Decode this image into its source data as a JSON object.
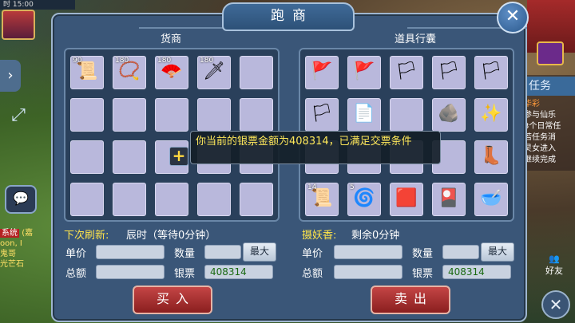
{
  "background": {
    "time_label": "时 15:00",
    "left_tab_icon": "chevron-right-icon",
    "chat_icon": "chat-bubble-icon",
    "chat_lines": [
      "系统",
      "(嘉",
      "oon, I",
      "鬼哥",
      "光芒石"
    ],
    "task_tab": "任务",
    "task_lines": [
      "华彩",
      "参与仙乐",
      "3个日常任",
      "若任务消",
      "灵女进入",
      "继续完成"
    ],
    "friend_label": "好友"
  },
  "dialog": {
    "title": "跑商",
    "close_icon": "✕",
    "shop": {
      "title": "货商",
      "items": [
        {
          "qty": "90",
          "icon": "scroll-icon",
          "glyph": "📜"
        },
        {
          "qty": "180",
          "icon": "prayer-beads-icon",
          "glyph": "📿"
        },
        {
          "qty": "180",
          "icon": "fan-icon",
          "glyph": "🪭"
        },
        {
          "qty": "180",
          "icon": "hairpin-icon",
          "glyph": "🗡"
        },
        {
          "qty": "",
          "icon": "",
          "glyph": ""
        },
        {
          "qty": "",
          "icon": "",
          "glyph": ""
        },
        {
          "qty": "",
          "icon": "",
          "glyph": ""
        },
        {
          "qty": "",
          "icon": "",
          "glyph": ""
        },
        {
          "qty": "",
          "icon": "",
          "glyph": ""
        },
        {
          "qty": "",
          "icon": "",
          "glyph": ""
        },
        {
          "qty": "",
          "icon": "",
          "glyph": ""
        },
        {
          "qty": "",
          "icon": "",
          "glyph": ""
        },
        {
          "qty": "",
          "icon": "",
          "glyph": ""
        },
        {
          "qty": "",
          "icon": "",
          "glyph": ""
        },
        {
          "qty": "",
          "icon": "",
          "glyph": ""
        },
        {
          "qty": "",
          "icon": "",
          "glyph": ""
        },
        {
          "qty": "",
          "icon": "",
          "glyph": ""
        },
        {
          "qty": "",
          "icon": "",
          "glyph": ""
        },
        {
          "qty": "",
          "icon": "",
          "glyph": ""
        },
        {
          "qty": "",
          "icon": "",
          "glyph": ""
        }
      ],
      "refresh_label": "下次刷新:",
      "refresh_value": "辰时（等待0分钟）",
      "unit_price_label": "单价",
      "quantity_label": "数量",
      "max_label": "最大",
      "total_label": "总额",
      "silver_label": "银票",
      "silver_value": "408314",
      "buy_label": "买入"
    },
    "bag": {
      "title": "道具行囊",
      "items": [
        {
          "qty": "",
          "icon": "red-banner-icon",
          "glyph": "🚩"
        },
        {
          "qty": "",
          "icon": "red-banner-icon",
          "glyph": "🚩"
        },
        {
          "qty": "",
          "icon": "yellow-banner-icon",
          "glyph": "🏳"
        },
        {
          "qty": "",
          "icon": "yellow-banner-icon",
          "glyph": "🏳"
        },
        {
          "qty": "",
          "icon": "green-banner-icon",
          "glyph": "🏳"
        },
        {
          "qty": "",
          "icon": "yellow-banner-icon",
          "glyph": "🏳"
        },
        {
          "qty": "",
          "icon": "paper-note-icon",
          "glyph": "📄"
        },
        {
          "qty": "",
          "icon": "",
          "glyph": ""
        },
        {
          "qty": "",
          "icon": "stone-tablet-icon",
          "glyph": "🪨"
        },
        {
          "qty": "",
          "icon": "spirit-orb-icon",
          "glyph": "✨"
        },
        {
          "qty": "",
          "icon": "",
          "glyph": ""
        },
        {
          "qty": "",
          "icon": "",
          "glyph": ""
        },
        {
          "qty": "",
          "icon": "",
          "glyph": ""
        },
        {
          "qty": "",
          "icon": "",
          "glyph": ""
        },
        {
          "qty": "",
          "icon": "boots-icon",
          "glyph": "👢"
        },
        {
          "qty": "14",
          "icon": "scroll-icon",
          "glyph": "📜"
        },
        {
          "qty": "5",
          "icon": "incense-coil-icon",
          "glyph": "🌀"
        },
        {
          "qty": "",
          "icon": "red-carpet-icon",
          "glyph": "🟥"
        },
        {
          "qty": "",
          "icon": "talisman-card-icon",
          "glyph": "🎴"
        },
        {
          "qty": "",
          "icon": "bowl-icon",
          "glyph": "🥣"
        }
      ],
      "incense_label": "摄妖香:",
      "incense_value": "剩余0分钟",
      "unit_price_label": "单价",
      "quantity_label": "数量",
      "max_label": "最大",
      "total_label": "总额",
      "silver_label": "银票",
      "silver_value": "408314",
      "sell_label": "卖出"
    },
    "tooltip": "你当前的银票金额为408314，已满足交票条件",
    "plus_icon": "+"
  }
}
